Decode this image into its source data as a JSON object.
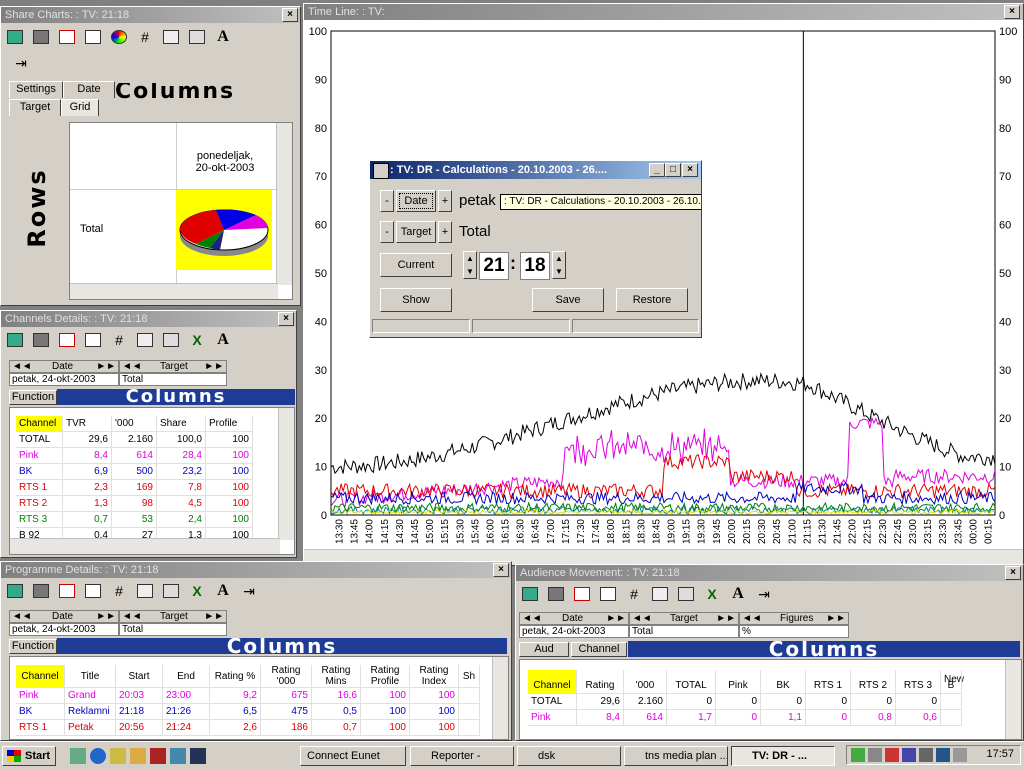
{
  "share_charts": {
    "title": "Share Charts: : TV:  21:18",
    "tabs": {
      "settings": "Settings",
      "date": "Date",
      "target": "Target",
      "grid": "Grid"
    },
    "columns_banner": "Columns",
    "rows_banner": "Rows",
    "column_header": "ponedeljak,\n20-okt-2003",
    "row_label": "Total"
  },
  "timeline": {
    "title": "Time Line: : TV:",
    "y_ticks": [
      "100",
      "90",
      "80",
      "70",
      "60",
      "50",
      "40",
      "30",
      "20",
      "10",
      "0"
    ],
    "x_ticks": [
      "13:30",
      "13:45",
      "14:00",
      "14:15",
      "14:30",
      "14:45",
      "15:00",
      "15:15",
      "15:30",
      "15:45",
      "16:00",
      "16:15",
      "16:30",
      "16:45",
      "17:00",
      "17:15",
      "17:30",
      "17:45",
      "18:00",
      "18:15",
      "18:30",
      "18:45",
      "19:00",
      "19:15",
      "19:30",
      "19:45",
      "20:00",
      "20:15",
      "20:30",
      "20:45",
      "21:00",
      "21:15",
      "21:30",
      "21:45",
      "22:00",
      "22:15",
      "22:30",
      "22:45",
      "23:00",
      "23:15",
      "23:30",
      "23:45",
      "00:00",
      "00:15"
    ],
    "colors": {
      "total": "#000000",
      "pink": "#e000e0",
      "red": "#e00000",
      "blue": "#0000c0",
      "green": "#008000",
      "yellow": "#e0e000",
      "teal": "#008080"
    }
  },
  "calc_dialog": {
    "title": ": TV: DR - Calculations - 20.10.2003 - 26....",
    "tooltip": ": TV: DR - Calculations - 20.10.2003 - 26.10.2003",
    "date_btn": "Date",
    "date_value": "petak",
    "target_btn": "Target",
    "target_value": "Total",
    "minus": "-",
    "plus": "+",
    "current_btn": "Current",
    "hour": "21",
    "sep": ":",
    "minute": "18",
    "show_btn": "Show",
    "save_btn": "Save",
    "restore_btn": "Restore"
  },
  "channels": {
    "title": "Channels Details: : TV:  21:18",
    "date_label": "Date",
    "target_label": "Target",
    "date_value": "petak, 24-okt-2003",
    "target_value": "Total",
    "function_btn": "Function",
    "columns_banner": "Columns",
    "headers": [
      "Channel",
      "TVR",
      "'000",
      "Share",
      "Profile"
    ],
    "rows": [
      {
        "c": "TOTAL",
        "tvr": "29,6",
        "k": "2.160",
        "share": "100,0",
        "profile": "100",
        "color": "#000000"
      },
      {
        "c": "Pink",
        "tvr": "8,4",
        "k": "614",
        "share": "28,4",
        "profile": "100",
        "color": "#e000e0"
      },
      {
        "c": "BK",
        "tvr": "6,9",
        "k": "500",
        "share": "23,2",
        "profile": "100",
        "color": "#0000c0"
      },
      {
        "c": "RTS 1",
        "tvr": "2,3",
        "k": "169",
        "share": "7,8",
        "profile": "100",
        "color": "#e00000"
      },
      {
        "c": "RTS 2",
        "tvr": "1,3",
        "k": "98",
        "share": "4,5",
        "profile": "100",
        "color": "#e00000"
      },
      {
        "c": "RTS 3",
        "tvr": "0,7",
        "k": "53",
        "share": "2,4",
        "profile": "100",
        "color": "#008000"
      },
      {
        "c": "B 92",
        "tvr": "0,4",
        "k": "27",
        "share": "1,3",
        "profile": "100",
        "color": "#000000"
      }
    ]
  },
  "programme": {
    "title": "Programme Details: : TV:  21:18",
    "date_label": "Date",
    "target_label": "Target",
    "date_value": "petak, 24-okt-2003",
    "target_value": "Total",
    "function_btn": "Function",
    "columns_banner": "Columns",
    "headers": [
      "Channel",
      "Title",
      "Start",
      "End",
      "Rating %",
      "Rating '000",
      "Rating Mins",
      "Rating Profile",
      "Rating Index",
      "Sh"
    ],
    "rows": [
      {
        "c": "Pink",
        "t": "Grand",
        "s": "20:03",
        "e": "23:00",
        "r": "9,2",
        "k": "675",
        "m": "16,6",
        "p": "100",
        "i": "100",
        "color": "#e000e0"
      },
      {
        "c": "BK",
        "t": "Reklamni",
        "s": "21:18",
        "e": "21:26",
        "r": "6,5",
        "k": "475",
        "m": "0,5",
        "p": "100",
        "i": "100",
        "color": "#0000c0"
      },
      {
        "c": "RTS 1",
        "t": "Petak",
        "s": "20:56",
        "e": "21:24",
        "r": "2,6",
        "k": "186",
        "m": "0,7",
        "p": "100",
        "i": "100",
        "color": "#e00000"
      }
    ]
  },
  "audience": {
    "title": "Audience Movement: : TV:  21:18",
    "date_label": "Date",
    "target_label": "Target",
    "figures_label": "Figures",
    "date_value": "petak, 24-okt-2003",
    "target_value": "Total",
    "figures_value": "%",
    "tab_aud": "Aud",
    "tab_channel": "Channel",
    "columns_banner": "Columns",
    "new_label": "New",
    "headers": [
      "Channel",
      "Rating",
      "'000",
      "TOTAL",
      "Pink",
      "BK",
      "RTS 1",
      "RTS 2",
      "RTS 3",
      "B"
    ],
    "rows": [
      {
        "cells": [
          "TOTAL",
          "29,6",
          "2.160",
          "0",
          "0",
          "0",
          "0",
          "0",
          "0",
          ""
        ],
        "color": "#000000"
      },
      {
        "cells": [
          "Pink",
          "8,4",
          "614",
          "1,7",
          "0",
          "1,1",
          "0",
          "0,8",
          "0,6",
          ""
        ],
        "color": "#e000e0"
      }
    ]
  },
  "taskbar": {
    "start": "Start",
    "items": [
      "Connect Eunet",
      "Reporter -",
      "dsk",
      "tns media plan ...",
      "TV: DR - ..."
    ],
    "clock": "17:57"
  }
}
